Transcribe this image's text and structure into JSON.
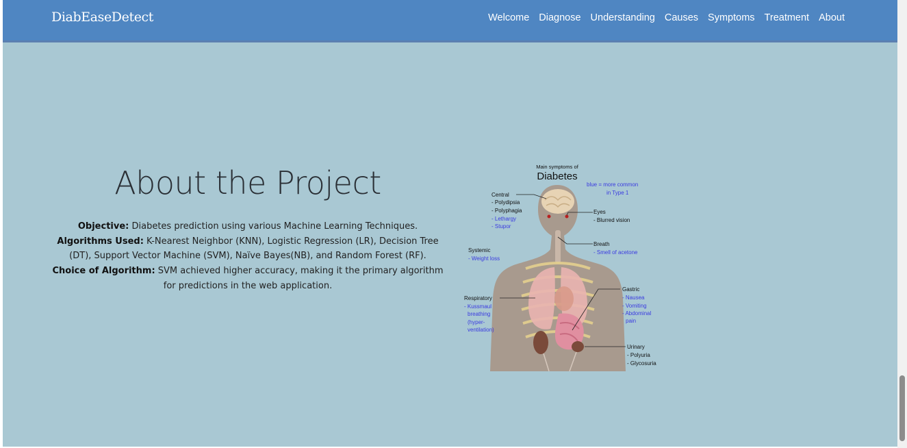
{
  "brand": "DiabEaseDetect",
  "nav": [
    {
      "label": "Welcome"
    },
    {
      "label": "Diagnose"
    },
    {
      "label": "Understanding"
    },
    {
      "label": "Causes"
    },
    {
      "label": "Symptoms"
    },
    {
      "label": "Treatment"
    },
    {
      "label": "About"
    }
  ],
  "about": {
    "title": "About the Project",
    "objective_label": "Objective:",
    "objective_text": " Diabetes prediction using various Machine Learning Techniques.",
    "algorithms_label": "Algorithms Used:",
    "algorithms_text": " K-Nearest Neighbor (KNN), Logistic Regression (LR), Decision Tree (DT), Support Vector Machine (SVM), Naïve Bayes(NB), and Random Forest (RF).",
    "choice_label": "Choice of Algorithm:",
    "choice_text": " SVM achieved higher accuracy, making it the primary algorithm for predictions in the web application."
  },
  "diagram": {
    "subtitle": "Main symptoms of",
    "title": "Diabetes",
    "legend_line1": "blue = more common",
    "legend_line2": "in Type 1",
    "central": "Central",
    "polydipsia": "- Polydipsia",
    "polyphagia": "- Polyphagia",
    "lethargy": "- Lethargy",
    "stupor": "- Stupor",
    "eyes": "Eyes",
    "blurred": "- Blurred vision",
    "systemic": "Systemic",
    "weight_loss": "- Weight loss",
    "breath": "Breath",
    "acetone": "- Smell of acetone",
    "respiratory": "Respiratory",
    "kussmaul": "- Kussmaul",
    "breathing": "breathing",
    "hyper": "(hyper-",
    "ventilation": "ventilation)",
    "gastric": "Gastric",
    "nausea": "- Nausea",
    "vomiting": "- Vomiting",
    "abdominal": "- Abdominal",
    "pain": "pain",
    "urinary": "Urinary",
    "polyuria": "- Polyuria",
    "glycosuria": "- Glycosuria"
  },
  "colors": {
    "page_bg": "#a9c8d3",
    "navbar_bg": "#4f86c2",
    "blue_label": "#3a3ae0",
    "body_skin": "#a89a8e"
  }
}
